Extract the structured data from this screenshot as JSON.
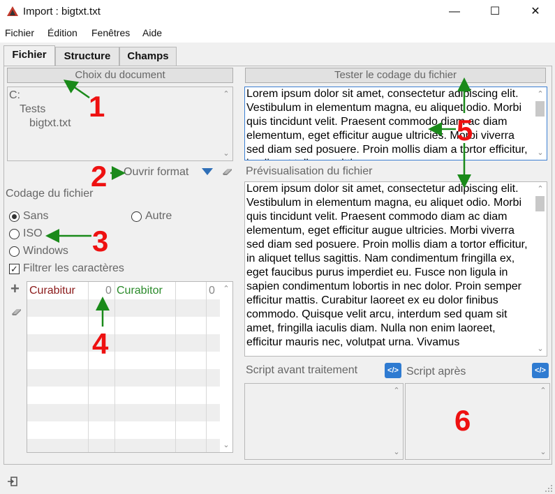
{
  "window": {
    "title": "Import : bigtxt.txt",
    "minimize": "—",
    "maximize": "☐",
    "close": "✕"
  },
  "menu": [
    "Fichier",
    "Édition",
    "Fenêtres",
    "Aide"
  ],
  "tabs": [
    {
      "label": "Fichier",
      "active": true
    },
    {
      "label": "Structure",
      "active": false
    },
    {
      "label": "Champs",
      "active": false
    }
  ],
  "left": {
    "choose_doc_button": "Choix du document",
    "tree": [
      "C:",
      "Tests",
      "bigtxt.txt"
    ],
    "open_format": "Ouvrir format",
    "encoding_title": "Codage du fichier",
    "radio_sans": "Sans",
    "radio_autre": "Autre",
    "radio_iso": "ISO",
    "radio_windows": "Windows",
    "filter_label": "Filtrer les caractères",
    "filter_checked": true,
    "plus_sign": "+",
    "grid_header": {
      "col1": "Curabitur",
      "count1": "0",
      "col2": "Curabitor",
      "count2": "0"
    }
  },
  "right": {
    "test_encoding_button": "Tester le codage du fichier",
    "test_text": "Lorem ipsum dolor sit amet, consectetur adipiscing elit. Vestibulum in elementum magna, eu aliquet odio. Morbi quis tincidunt velit. Praesent commodo diam ac diam elementum, eget efficitur augue ultricies. Morbi viverra sed diam sed posuere. Proin mollis diam a tortor efficitur, in aliquet tellus sagittis.",
    "preview_title": "Prévisualisation du fichier",
    "preview_text": "Lorem ipsum dolor sit amet, consectetur adipiscing elit. Vestibulum in elementum magna, eu aliquet odio. Morbi quis tincidunt velit. Praesent commodo diam ac diam elementum, eget efficitur augue ultricies. Morbi viverra sed diam sed posuere. Proin mollis diam a tortor efficitur, in aliquet tellus sagittis. Nam condimentum fringilla ex, eget faucibus purus imperdiet eu. Fusce non ligula in sapien condimentum lobortis in nec dolor. Proin semper efficitur mattis. Curabitur laoreet ex eu dolor finibus commodo. Quisque velit arcu, interdum sed quam sit amet, fringilla iaculis diam. Nulla non enim laoreet, efficitur mauris nec, volutpat urna. Vivamus",
    "script_before": "Script avant traitement",
    "script_after": "Script après",
    "code_icon_label": "</>"
  },
  "annotations": [
    "1",
    "2",
    "3",
    "4",
    "5",
    "6"
  ],
  "colors": {
    "annotation": "#ee1111",
    "arrow": "#1a8a1a",
    "accent": "#2f7bd1",
    "curabitur": "#8b1a1a",
    "curabitor": "#2a8a2a"
  }
}
